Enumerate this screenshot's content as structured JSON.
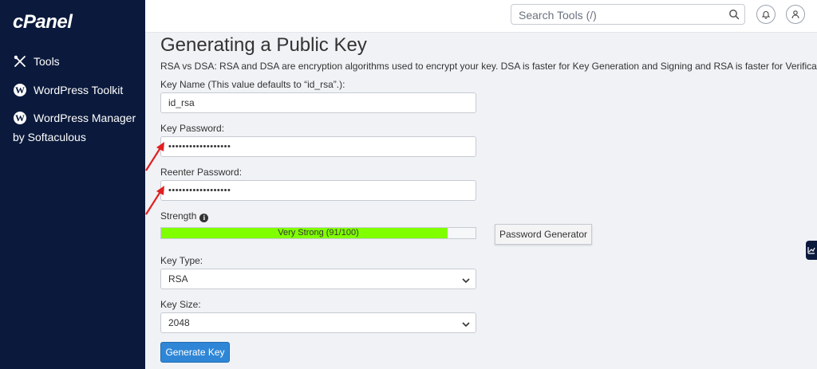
{
  "brand": {
    "logo": "cPanel"
  },
  "sidebar": {
    "items": [
      {
        "label": "Tools",
        "icon": "tools-icon"
      },
      {
        "label": "WordPress Toolkit",
        "icon": "wordpress-icon"
      },
      {
        "label": "WordPress Manager",
        "sub": "by Softaculous",
        "icon": "wordpress-icon"
      }
    ]
  },
  "topbar": {
    "search_placeholder": "Search Tools (/)"
  },
  "page": {
    "title": "Generating a Public Key",
    "description": "RSA vs DSA: RSA and DSA are encryption algorithms used to encrypt your key. DSA is faster for Key Generation and Signing and RSA is faster for Verification."
  },
  "form": {
    "key_name_label": "Key Name (This value defaults to “id_rsa”.):",
    "key_name_value": "id_rsa",
    "key_password_label": "Key Password:",
    "key_password_value": "••••••••••••••••••",
    "reenter_password_label": "Reenter Password:",
    "reenter_password_value": "••••••••••••••••••",
    "strength_label": "Strength",
    "strength_text": "Very Strong (91/100)",
    "strength_percent": 91,
    "password_generator_label": "Password Generator",
    "key_type_label": "Key Type:",
    "key_type_value": "RSA",
    "key_size_label": "Key Size:",
    "key_size_value": "2048",
    "generate_label": "Generate Key"
  },
  "colors": {
    "sidebar_bg": "#0b1a3c",
    "strength_fill": "#7fff00",
    "primary_button": "#2f86d6",
    "annotation_arrow": "#e02020"
  }
}
